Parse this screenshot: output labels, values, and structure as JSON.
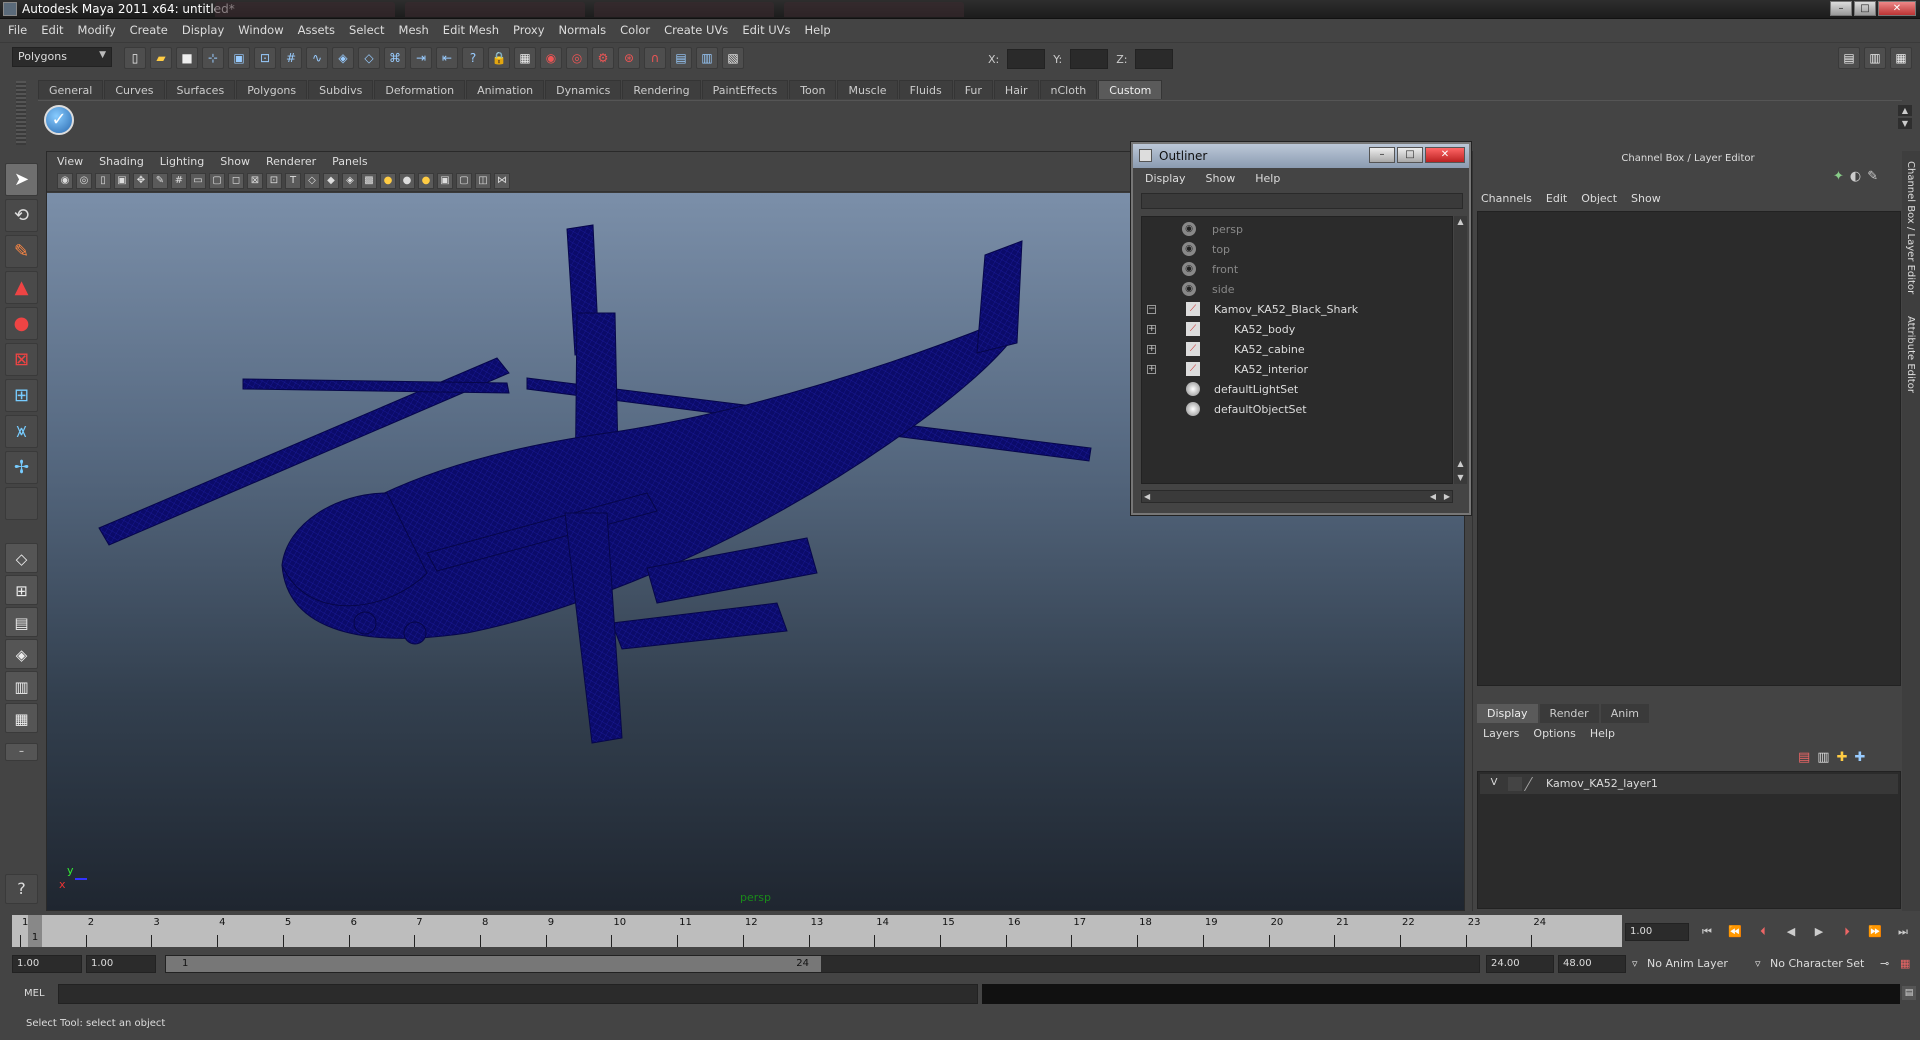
{
  "window": {
    "title": "Autodesk Maya 2011 x64: untitled*"
  },
  "menubar": [
    "File",
    "Edit",
    "Modify",
    "Create",
    "Display",
    "Window",
    "Assets",
    "Select",
    "Mesh",
    "Edit Mesh",
    "Proxy",
    "Normals",
    "Color",
    "Create UVs",
    "Edit UVs",
    "Help"
  ],
  "statusline": {
    "mode": "Polygons",
    "x_label": "X:",
    "y_label": "Y:",
    "z_label": "Z:"
  },
  "shelf": {
    "tabs": [
      "General",
      "Curves",
      "Surfaces",
      "Polygons",
      "Subdivs",
      "Deformation",
      "Animation",
      "Dynamics",
      "Rendering",
      "PaintEffects",
      "Toon",
      "Muscle",
      "Fluids",
      "Fur",
      "Hair",
      "nCloth",
      "Custom"
    ],
    "active_tab": "Custom"
  },
  "viewport": {
    "menu": [
      "View",
      "Shading",
      "Lighting",
      "Show",
      "Renderer",
      "Panels"
    ],
    "camera": "persp",
    "axis": {
      "x": "x",
      "y": "y"
    },
    "wire_color": "#0a0a6e"
  },
  "outliner": {
    "title": "Outliner",
    "menu": [
      "Display",
      "Show",
      "Help"
    ],
    "items": [
      {
        "label": "persp",
        "type": "camera",
        "dim": true
      },
      {
        "label": "top",
        "type": "camera",
        "dim": true
      },
      {
        "label": "front",
        "type": "camera",
        "dim": true
      },
      {
        "label": "side",
        "type": "camera",
        "dim": true
      },
      {
        "label": "Kamov_KA52_Black_Shark",
        "type": "transform",
        "expander": "−"
      },
      {
        "label": "KA52_body",
        "type": "transform",
        "expander": "+"
      },
      {
        "label": "KA52_cabine",
        "type": "transform",
        "expander": "+"
      },
      {
        "label": "KA52_interior",
        "type": "transform",
        "expander": "+"
      },
      {
        "label": "defaultLightSet",
        "type": "set"
      },
      {
        "label": "defaultObjectSet",
        "type": "set"
      }
    ]
  },
  "channelbox": {
    "title": "Channel Box / Layer Editor",
    "menu": [
      "Channels",
      "Edit",
      "Object",
      "Show"
    ],
    "side_tabs": [
      "Channel Box / Layer Editor",
      "Attribute Editor"
    ]
  },
  "layer_editor": {
    "tabs": [
      "Display",
      "Render",
      "Anim"
    ],
    "active_tab": "Display",
    "menu": [
      "Layers",
      "Options",
      "Help"
    ],
    "layers": [
      {
        "visible": "V",
        "name": "Kamov_KA52_layer1"
      }
    ]
  },
  "timeslider": {
    "ticks": [
      "1",
      "2",
      "3",
      "4",
      "5",
      "6",
      "7",
      "8",
      "9",
      "10",
      "11",
      "12",
      "13",
      "14",
      "15",
      "16",
      "17",
      "18",
      "19",
      "20",
      "21",
      "22",
      "23",
      "24"
    ],
    "current_frame": "1",
    "current_time_field": "1.00"
  },
  "rangeslider": {
    "start_time": "1.00",
    "playback_start": "1.00",
    "range_start_label": "1",
    "range_end_label": "24",
    "playback_end": "24.00",
    "end_time": "48.00",
    "anim_layer": "No Anim Layer",
    "character_set": "No Character Set"
  },
  "cmdline": {
    "label": "MEL"
  },
  "helpline": {
    "text": "Select Tool: select an object"
  }
}
